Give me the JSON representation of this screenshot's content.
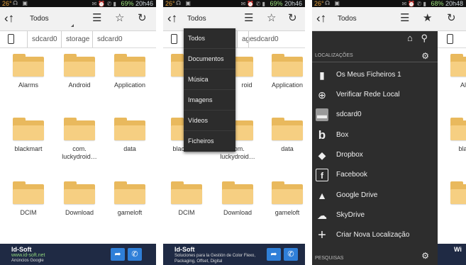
{
  "status": {
    "temp": "26°",
    "panels": [
      {
        "battery": "69%",
        "time": "20h46"
      },
      {
        "battery": "69%",
        "time": "20h46"
      },
      {
        "battery": "68%",
        "time": "20h48"
      }
    ]
  },
  "actionbar": {
    "title": "Todos"
  },
  "path": {
    "crumbs": [
      "sdcard0",
      "storage",
      "sdcard0"
    ],
    "crumbs_partial": [
      "age",
      "sdcard0"
    ]
  },
  "folders": [
    "Alarms",
    "Android",
    "Application",
    "blackmart",
    "com.\nluckydroid…",
    "data",
    "DCIM",
    "Download",
    "gameloft"
  ],
  "folders_panel2_partial": [
    "Al",
    "roid",
    "Application",
    "blackmart",
    "com.\nluckydroid…",
    "data",
    "DCIM",
    "Download",
    "gameloft"
  ],
  "panel3_partial_labels": [
    "Alar",
    "black"
  ],
  "dropdown": {
    "items": [
      "Todos",
      "Documentos",
      "Música",
      "Imagens",
      "Vídeos",
      "Ficheiros"
    ]
  },
  "drawer": {
    "section_locations": "LOCALIZAÇÕES",
    "section_searches": "PESQUISAS",
    "items": [
      {
        "label": "Os Meus Ficheiros 1",
        "icon": "sd-card-icon"
      },
      {
        "label": "Verificar Rede Local",
        "icon": "crosshair-icon"
      },
      {
        "label": "sdcard0",
        "icon": "folder-icon"
      },
      {
        "label": "Box",
        "icon": "box-icon"
      },
      {
        "label": "Dropbox",
        "icon": "dropbox-icon"
      },
      {
        "label": "Facebook",
        "icon": "facebook-icon"
      },
      {
        "label": "Google Drive",
        "icon": "google-drive-icon"
      },
      {
        "label": "SkyDrive",
        "icon": "cloud-icon"
      },
      {
        "label": "Criar Nova Localização",
        "icon": "plus-icon"
      }
    ]
  },
  "ad": {
    "brand": "Id-Soft",
    "url": "www.id-soft.net",
    "sub": "Anúncios Google",
    "desc": "Soluciones para la Gestión de Color Flexo, Packaging, Offset, Digital",
    "partial": "Wi"
  },
  "colors": {
    "folder": "#f6cf82",
    "drawer_bg": "#2d2d2d",
    "dropdown_bg": "#2c2c2c",
    "ad_bg": "#1f2a44",
    "ad_button": "#2f7fd8"
  }
}
